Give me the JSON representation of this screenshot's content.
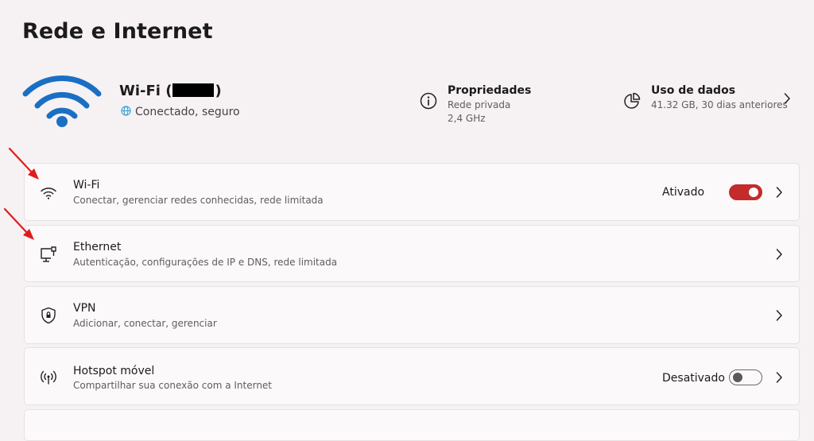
{
  "page": {
    "title": "Rede e Internet"
  },
  "connection": {
    "name_prefix": "Wi-Fi (",
    "name_suffix": ")",
    "status": "Conectado, seguro",
    "icon": "wifi-large-icon"
  },
  "properties": {
    "title": "Propriedades",
    "line1": "Rede privada",
    "line2": "2,4 GHz",
    "icon": "info-icon"
  },
  "data_usage": {
    "title": "Uso de dados",
    "detail": "41.32 GB, 30 dias anteriores",
    "icon": "pie-chart-icon"
  },
  "settings": [
    {
      "title": "Wi-Fi",
      "description": "Conectar, gerenciar redes conhecidas, rede limitada",
      "icon": "wifi-icon",
      "state": "Ativado",
      "toggle_on": true
    },
    {
      "title": "Ethernet",
      "description": "Autenticação, configurações de IP e DNS, rede limitada",
      "icon": "ethernet-icon"
    },
    {
      "title": "VPN",
      "description": "Adicionar, conectar, gerenciar",
      "icon": "vpn-shield-icon"
    },
    {
      "title": "Hotspot móvel",
      "description": "Compartilhar sua conexão com a Internet",
      "icon": "hotspot-icon",
      "state": "Desativado",
      "toggle_on": false
    }
  ],
  "colors": {
    "accent": "#c42b2b",
    "wifi_icon_blue": "#1a6fc4",
    "annotation_arrow": "#e01c1c",
    "background": "#f6f1f3",
    "card": "#fbf9fa"
  }
}
